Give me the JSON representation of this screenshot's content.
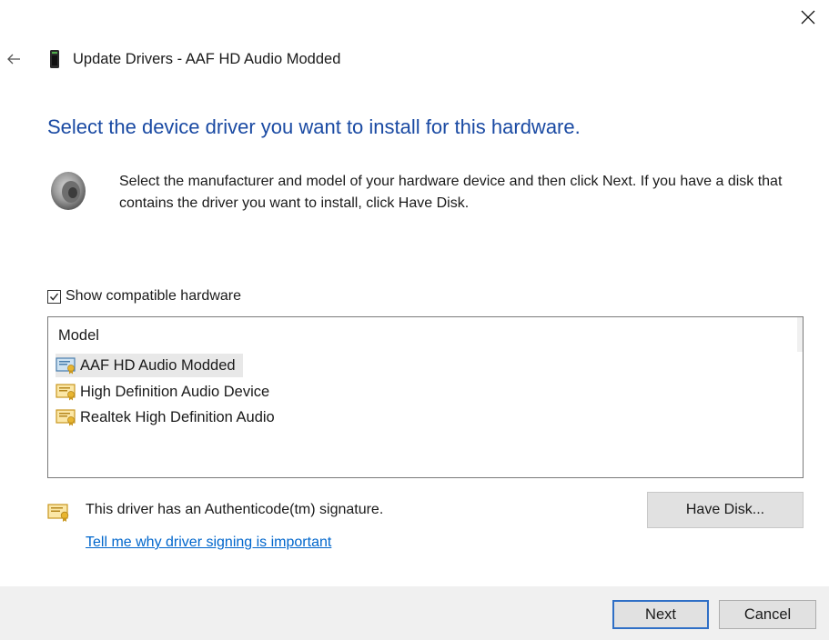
{
  "window": {
    "title": "Update Drivers - AAF HD Audio Modded",
    "close_icon": "close-icon",
    "back_icon": "back-arrow-icon"
  },
  "main": {
    "heading": "Select the device driver you want to install for this hardware.",
    "instructions": "Select the manufacturer and model of your hardware device and then click Next. If you have a disk that contains the driver you want to install, click Have Disk.",
    "show_compatible": {
      "label": "Show compatible hardware",
      "checked": true
    },
    "model_list": {
      "header": "Model",
      "items": [
        {
          "label": "AAF HD Audio Modded",
          "selected": true
        },
        {
          "label": "High Definition Audio Device",
          "selected": false
        },
        {
          "label": "Realtek High Definition Audio",
          "selected": false
        }
      ]
    },
    "signature_text": "This driver has an Authenticode(tm) signature.",
    "signing_link": "Tell me why driver signing is important",
    "have_disk_label": "Have Disk..."
  },
  "footer": {
    "next_label": "Next",
    "cancel_label": "Cancel"
  },
  "colors": {
    "heading": "#1a4aa3",
    "link": "#0066cc",
    "footer_bg": "#f0f0f0",
    "default_button_border": "#2f6fc6"
  }
}
